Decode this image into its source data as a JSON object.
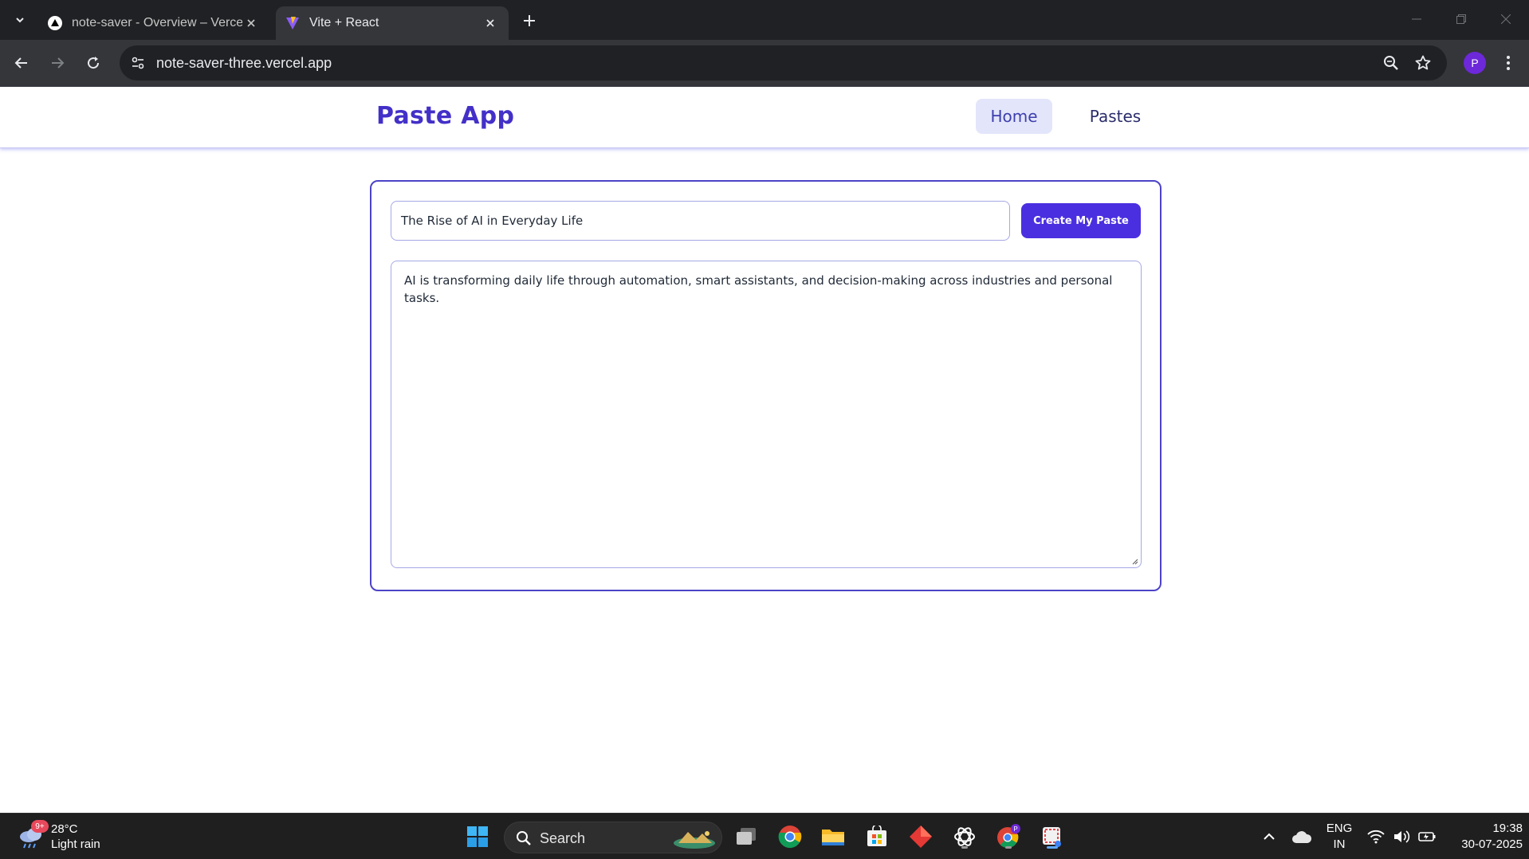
{
  "browser": {
    "tabs": [
      {
        "title": "note-saver - Overview – Vercel",
        "favicon": "vercel-triangle-icon",
        "active": false
      },
      {
        "title": "Vite + React",
        "favicon": "vite-icon",
        "active": true
      }
    ],
    "url": "note-saver-three.vercel.app",
    "profile_initial": "P"
  },
  "app": {
    "brand": "Paste App",
    "nav": [
      {
        "label": "Home",
        "active": true
      },
      {
        "label": "Pastes",
        "active": false
      }
    ],
    "form": {
      "title_value": "The Rise of AI in Everyday Life",
      "create_button_label": "Create My Paste",
      "content_value": "AI is transforming daily life through automation, smart assistants, and decision-making across industries and personal tasks."
    },
    "colors": {
      "brand": "#4330c8",
      "button": "#4a2fe0",
      "card_border": "#4c43c7",
      "active_nav_bg": "#e3e5fb"
    }
  },
  "taskbar": {
    "weather": {
      "temperature": "28°C",
      "condition": "Light rain",
      "badge": "9+"
    },
    "search_label": "Search",
    "language": {
      "line1": "ENG",
      "line2": "IN"
    },
    "clock": {
      "time": "19:38",
      "date": "30-07-2025"
    },
    "apps": [
      "windows-start-icon",
      "search-icon",
      "task-view-icon",
      "chrome-icon",
      "file-explorer-icon",
      "microsoft-store-icon",
      "red-diamond-app-icon",
      "chatgpt-icon",
      "chrome-profile-icon",
      "snipping-tool-icon"
    ]
  }
}
